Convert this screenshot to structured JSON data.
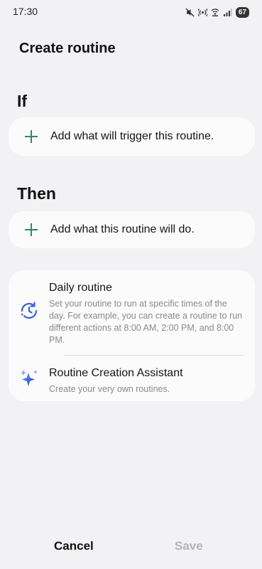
{
  "status_bar": {
    "time": "17:30",
    "battery": "67",
    "icons": [
      "mute-icon",
      "hotspot-icon",
      "wifi-calling-icon",
      "signal-icon"
    ]
  },
  "header": {
    "title": "Create routine"
  },
  "if_section": {
    "title": "If",
    "add_label": "Add what will trigger this routine."
  },
  "then_section": {
    "title": "Then",
    "add_label": "Add what this routine will do."
  },
  "suggestions": [
    {
      "title": "Daily routine",
      "description": "Set your routine to run at specific times of the day. For example, you can create a routine to run different actions at 8:00 AM, 2:00 PM, and 8:00 PM.",
      "icon": "clock-cycle-icon"
    },
    {
      "title": "Routine Creation Assistant",
      "description": "Create your very own routines.",
      "icon": "sparkle-icon"
    }
  ],
  "footer": {
    "cancel_label": "Cancel",
    "save_label": "Save"
  },
  "colors": {
    "accent_plus": "#2e8b57",
    "disabled_text": "#b5b5b9",
    "background": "#f2f2f4"
  }
}
